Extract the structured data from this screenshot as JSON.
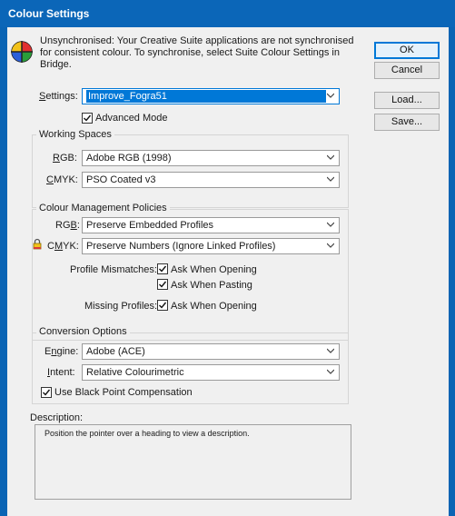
{
  "window": {
    "title": "Colour Settings"
  },
  "message": "Unsynchronised: Your Creative Suite applications are not synchronised for consistent colour. To synchronise, select Suite Colour Settings in Bridge.",
  "buttons": {
    "ok": "OK",
    "cancel": "Cancel",
    "load": "Load...",
    "save": "Save..."
  },
  "settings": {
    "label": "Settings:",
    "value": "Improve_Fogra51",
    "advanced_mode": "Advanced Mode",
    "advanced_checked": true
  },
  "working_spaces": {
    "title": "Working Spaces",
    "rgb_label": "RGB:",
    "rgb_value": "Adobe RGB (1998)",
    "cmyk_label": "CMYK:",
    "cmyk_value": "PSO Coated v3"
  },
  "policies": {
    "title": "Colour Management Policies",
    "rgb_label": "RGB:",
    "rgb_value": "Preserve Embedded Profiles",
    "cmyk_label": "CMYK:",
    "cmyk_value": "Preserve Numbers (Ignore Linked Profiles)",
    "mismatch_label": "Profile Mismatches:",
    "ask_opening": "Ask When Opening",
    "ask_pasting": "Ask When Pasting",
    "missing_label": "Missing Profiles:",
    "missing_ask_opening": "Ask When Opening"
  },
  "conversion": {
    "title": "Conversion Options",
    "engine_label": "Engine:",
    "engine_value": "Adobe (ACE)",
    "intent_label": "Intent:",
    "intent_value": "Relative Colourimetric",
    "black_point": "Use Black Point Compensation"
  },
  "description": {
    "label": "Description:",
    "text": "Position the pointer over a heading to view a description."
  },
  "colors": {
    "titlebar": "#0b66b8",
    "dialog_bg": "#f0f0f0",
    "accent": "#0078d7"
  }
}
